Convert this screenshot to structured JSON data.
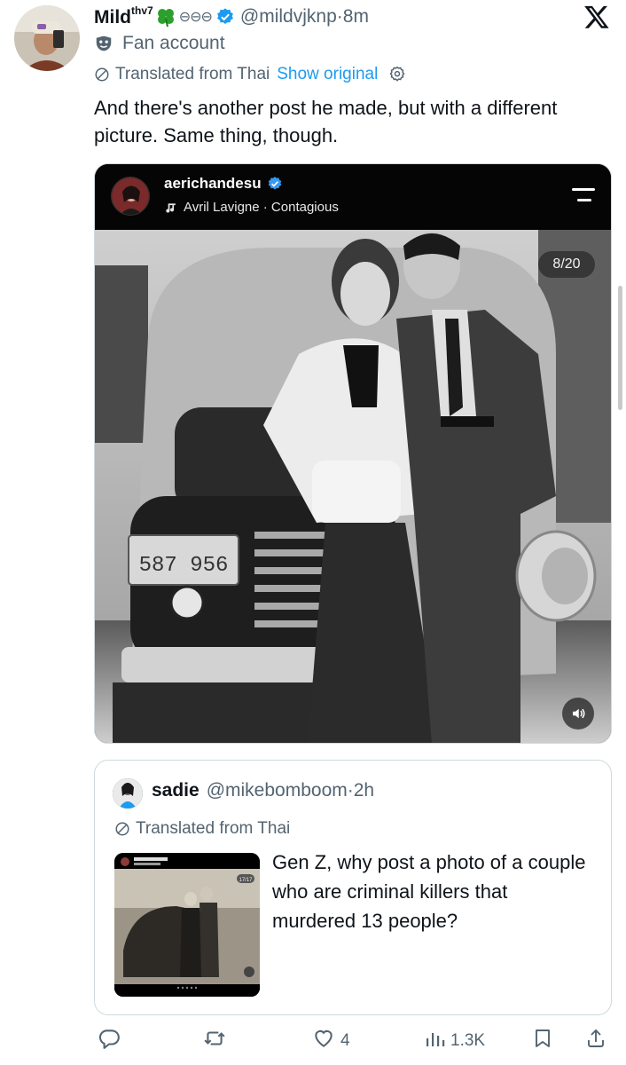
{
  "tweet": {
    "display_name": "Mild",
    "name_superscript": "thv7",
    "name_emoji_circles": "⊖⊖⊖",
    "handle": "@mildvjknp",
    "time": "·8m",
    "fan_label": "Fan account",
    "translated_label": "Translated from Thai",
    "show_original": "Show original",
    "text": "And there's another post he made, but with a different picture. Same thing, though."
  },
  "media": {
    "ig_username": "aerichandesu",
    "ig_song": "Avril Lavigne · Contagious",
    "slide_counter": "8/20",
    "plate_text": "587 956"
  },
  "quote": {
    "name": "sadie",
    "handle": "@mikebomboom",
    "time": "·2h",
    "translated_label": "Translated from Thai",
    "text": "Gen Z, why post a photo of a couple who are criminal killers that murdered 13 people?",
    "thumb_counter": "17/17"
  },
  "actions": {
    "reply_count": "",
    "retweet_count": "",
    "like_count": "4",
    "views_count": "1.3K"
  },
  "colors": {
    "text": "#0f1419",
    "secondary": "#536471",
    "link": "#1d9bf0",
    "verified": "#1d9bf0",
    "clover": "#2ca02c"
  },
  "icons": [
    "x-logo-icon",
    "mask-icon",
    "globe-icon",
    "gear-icon",
    "verified-icon",
    "music-note-icon",
    "menu-icon",
    "sound-icon",
    "reply-icon",
    "retweet-icon",
    "like-icon",
    "views-icon",
    "bookmark-icon",
    "share-icon"
  ]
}
